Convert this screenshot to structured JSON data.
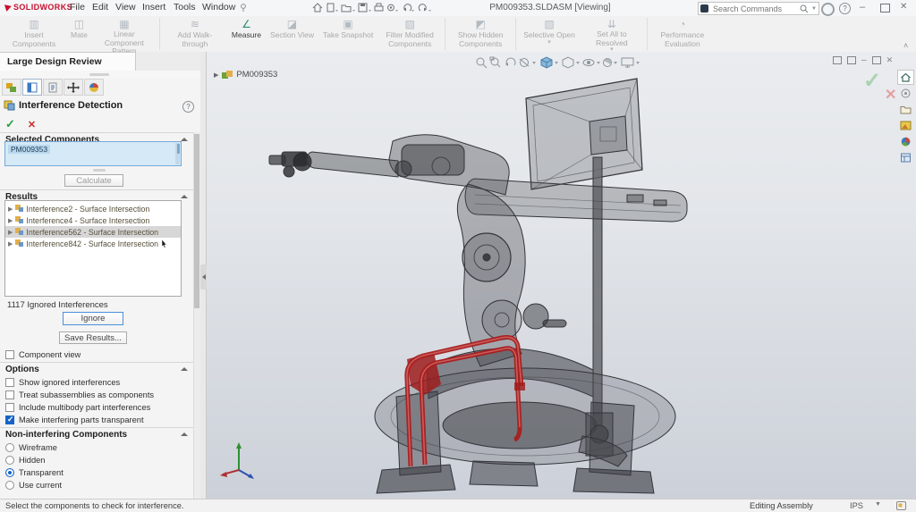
{
  "titlebar": {
    "logo_text": "SOLIDWORKS",
    "menus": [
      "File",
      "Edit",
      "View",
      "Insert",
      "Tools",
      "Window"
    ],
    "doc_title": "PM009353.SLDASM [Viewing]",
    "search_placeholder": "Search Commands",
    "help_glyph": "?",
    "minimize_glyph": "–",
    "close_glyph": "✕"
  },
  "quick_access_icons": [
    "welcome-home",
    "new-document",
    "open",
    "save",
    "print",
    "options",
    "undo",
    "redo"
  ],
  "ribbon": {
    "buttons": [
      {
        "label": "Insert Components",
        "enabled": false
      },
      {
        "label": "Mate",
        "enabled": false
      },
      {
        "label": "Linear Component Pattern",
        "enabled": false
      },
      {
        "label": "Add Walk-through",
        "enabled": false
      },
      {
        "label": "Measure",
        "enabled": true
      },
      {
        "label": "Section View",
        "enabled": false
      },
      {
        "label": "Take Snapshot",
        "enabled": false
      },
      {
        "label": "Filter Modified Components",
        "enabled": false
      },
      {
        "label": "Show Hidden Components",
        "enabled": false
      },
      {
        "label": "Selective Open",
        "enabled": false
      },
      {
        "label": "Set All to Resolved",
        "enabled": false
      },
      {
        "label": "Performance Evaluation",
        "enabled": false
      }
    ]
  },
  "leftpanel": {
    "tab": "Large Design Review",
    "pm_title": "Interference Detection",
    "ok_glyph": "✓",
    "cancel_glyph": "✕",
    "selected_components": {
      "header": "Selected Components",
      "value": "PM009353",
      "calculate_button": "Calculate"
    },
    "results": {
      "header": "Results",
      "items": [
        "Interference2 - Surface Intersection",
        "Interference4 - Surface Intersection",
        "Interference562 - Surface Intersection",
        "Interference842 - Surface Intersection"
      ],
      "selected_index": 2,
      "ignored_count": "1117 Ignored Interferences",
      "ignore_button": "Ignore",
      "save_button": "Save Results..."
    },
    "component_view_label": "Component view",
    "options": {
      "header": "Options",
      "items": [
        {
          "label": "Show ignored interferences",
          "checked": false
        },
        {
          "label": "Treat subassemblies as components",
          "checked": false
        },
        {
          "label": "Include multibody part interferences",
          "checked": false
        },
        {
          "label": "Make interfering parts transparent",
          "checked": true
        }
      ]
    },
    "non_interfering": {
      "header": "Non-interfering Components",
      "items": [
        {
          "label": "Wireframe",
          "selected": false
        },
        {
          "label": "Hidden",
          "selected": false
        },
        {
          "label": "Transparent",
          "selected": true
        },
        {
          "label": "Use current",
          "selected": false
        }
      ]
    }
  },
  "viewport": {
    "tree_root": "PM009353",
    "hud_icons": [
      "zoom-to-fit",
      "zoom-to-area",
      "previous-view",
      "section-view",
      "view-orientation",
      "display-style",
      "hide-show-items",
      "edit-appearance",
      "apply-scene",
      "view-settings"
    ],
    "taskpane_icons": [
      "home",
      "design-library",
      "file-explorer",
      "view-palette",
      "appearances",
      "custom-properties"
    ]
  },
  "statusbar": {
    "message": "Select the components to check for interference.",
    "mode": "Editing Assembly",
    "units": "IPS"
  },
  "colors": {
    "solidworks_red": "#c8102e",
    "accent_blue": "#1464c8",
    "interference_red": "#a81e1e",
    "confirm_green": "#2f9e3f",
    "viewport_top": "#eaecef",
    "viewport_bottom": "#ccd1d9"
  }
}
